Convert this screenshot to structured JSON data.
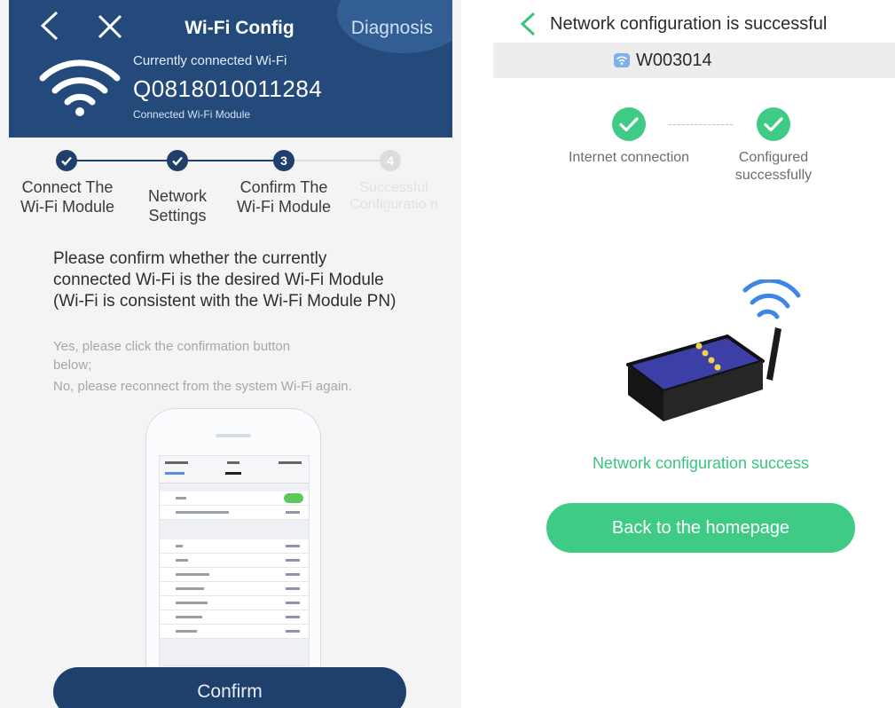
{
  "left_screen": {
    "header": {
      "title": "Wi-Fi Config",
      "diagnosis": "Diagnosis",
      "current_label": "Currently connected Wi-Fi",
      "ssid": "Q0818010011284",
      "module_label": "Connected Wi-Fi Module"
    },
    "steps": [
      {
        "label": "Connect The Wi-Fi Module",
        "state": "done"
      },
      {
        "label": "Network Settings",
        "state": "done"
      },
      {
        "label": "Confirm The Wi-Fi Module",
        "state": "current",
        "number": "3"
      },
      {
        "label": "Successful Configuratio n",
        "state": "pending",
        "number": "4"
      }
    ],
    "message": "Please confirm whether the currently connected Wi-Fi is the desired Wi-Fi Module (Wi-Fi is consistent with the Wi-Fi Module PN)",
    "hint_yes": "Yes, please click the confirmation button below;",
    "hint_no": "No, please reconnect from the system Wi-Fi again.",
    "confirm_label": "Confirm",
    "colors": {
      "header_bg": "#244a7b",
      "step_active": "#1f3f6d",
      "step_pending": "#dddddd"
    },
    "icons": {
      "back": "chevron-left-icon",
      "close": "close-icon",
      "wifi": "wifi-icon"
    }
  },
  "right_screen": {
    "title": "Network configuration is successful",
    "ssid": "W003014",
    "checks": [
      {
        "label": "Internet connection"
      },
      {
        "label": "Configured successfully"
      }
    ],
    "success_message": "Network configuration success",
    "home_button": "Back to the homepage",
    "colors": {
      "accent": "#3fcb85",
      "device_body": "#3b3fa6"
    },
    "icons": {
      "back": "chevron-left-icon",
      "check": "check-circle-icon",
      "device": "wifi-router-icon"
    }
  }
}
